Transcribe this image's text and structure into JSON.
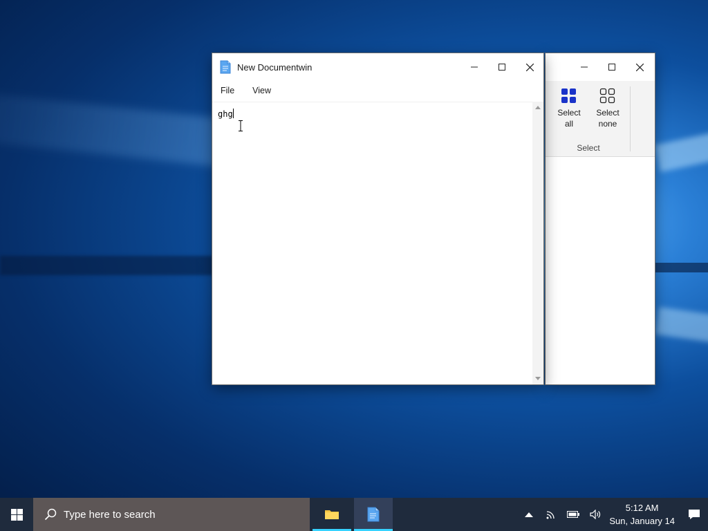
{
  "desktop": {
    "wallpaper": "Windows 10 hero"
  },
  "notepad": {
    "title": "New Documentwin",
    "menu": [
      "File",
      "View"
    ],
    "content": "ghg",
    "icon": "notepad-document-icon"
  },
  "explorer": {
    "ribbon": {
      "select_all_line1": "Select",
      "select_all_line2": "all",
      "select_none_line1": "Select",
      "select_none_line2": "none",
      "group_label": "Select"
    }
  },
  "taskbar": {
    "search_placeholder": "Type here to search",
    "apps": [
      {
        "name": "File Explorer",
        "icon": "folder-icon",
        "open": true
      },
      {
        "name": "Notepad",
        "icon": "notepad-icon",
        "open": true,
        "active": true
      }
    ],
    "clock": {
      "time": "5:12 AM",
      "date": "Sun, January 14"
    }
  },
  "colors": {
    "taskbar": "#1f2b3d",
    "search": "#5d5656",
    "accent": "#36d3ff",
    "ribbon_icon_blue": "#1a33c9"
  }
}
